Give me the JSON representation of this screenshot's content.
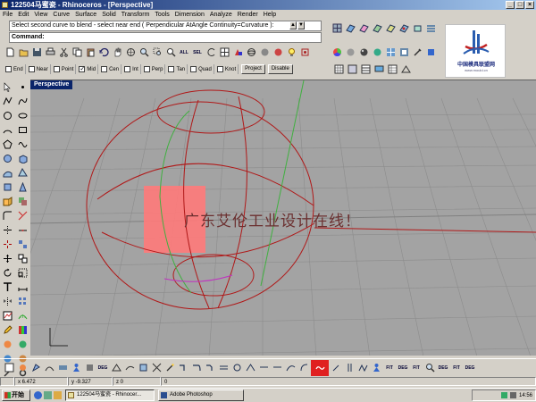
{
  "window": {
    "title": "122504马蜜瓷 - Rhinoceros - [Perspective]",
    "app_icon": "rhino-icon"
  },
  "menu": [
    "File",
    "Edit",
    "View",
    "Curve",
    "Surface",
    "Solid",
    "Transform",
    "Tools",
    "Dimension",
    "Analyze",
    "Render",
    "Help"
  ],
  "command": {
    "history": "Select second curve to blend - select near end ( Perpendicular  AtAngle  Continuity=Curvature ):",
    "prompt": "Command:",
    "value": ""
  },
  "osnap": {
    "items": [
      {
        "label": "End",
        "checked": false
      },
      {
        "label": "Near",
        "checked": false
      },
      {
        "label": "Point",
        "checked": false
      },
      {
        "label": "Mid",
        "checked": true
      },
      {
        "label": "Cen",
        "checked": false
      },
      {
        "label": "Int",
        "checked": false
      },
      {
        "label": "Perp",
        "checked": false
      },
      {
        "label": "Tan",
        "checked": false
      },
      {
        "label": "Quad",
        "checked": false
      },
      {
        "label": "Knot",
        "checked": false
      }
    ],
    "project_label": "Project",
    "disable_label": "Disable"
  },
  "toolbar_top": {
    "all_label": "ALL",
    "sel_label": "SEL"
  },
  "viewport": {
    "title": "Perspective",
    "watermark": "广东艾伦工业设计在线！"
  },
  "logo": {
    "name": "中国模具联盟网",
    "url": "www.mould.cn"
  },
  "bottom_toolbar": {
    "labels": [
      "DEG",
      "FIT",
      "DEG",
      "FIT",
      "DEG",
      "FIT",
      "DEG"
    ]
  },
  "status": {
    "x": "x 6.472",
    "y": "y -9.327",
    "z": "z 0",
    "extra": "0"
  },
  "taskbar": {
    "start_label": "开始",
    "items": [
      {
        "label": "122504马蜜瓷 - Rhinocer...",
        "active": true
      },
      {
        "label": "Adobe Photoshop",
        "active": false
      }
    ],
    "time": "14:56"
  },
  "colors": {
    "title_gradient_start": "#0a246a",
    "viewport_bg": "#a3a3a3",
    "curve_red": "#b01818",
    "curve_green": "#40b040",
    "curve_magenta": "#c030c0",
    "highlight_pink": "#ff7a7a",
    "active_button_red": "#e02020"
  }
}
